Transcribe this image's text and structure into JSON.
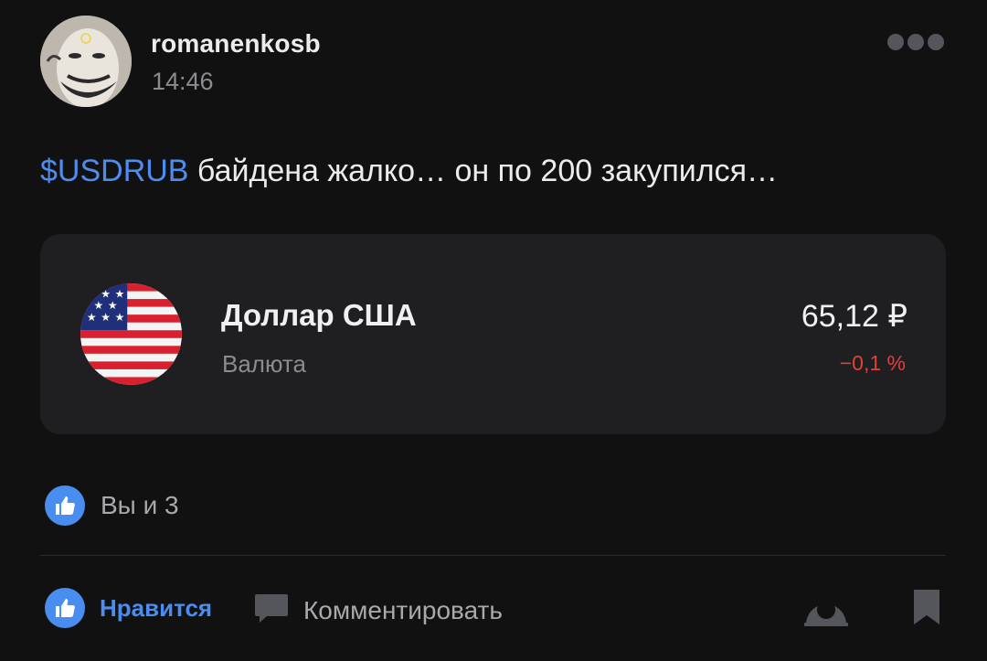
{
  "post": {
    "author": "romanenkosb",
    "time": "14:46",
    "ticker": "$USDRUB",
    "text": " байдена жалко… он по 200 закупился…"
  },
  "instrument": {
    "name": "Доллар США",
    "type": "Валюта",
    "price": "65,12 ₽",
    "change": "−0,1 %",
    "flag_icon": "us-flag-icon"
  },
  "reactions": {
    "likes_summary": "Вы и 3"
  },
  "actions": {
    "like_label": "Нравится",
    "comment_label": "Комментировать"
  },
  "colors": {
    "background": "#111112",
    "card": "#1f1f21",
    "accent": "#4a8df0",
    "negative": "#e0403a",
    "muted": "#8b8b90"
  },
  "icons": [
    "more-icon",
    "thumbs-up-icon",
    "comment-icon",
    "share-icon",
    "bookmark-icon"
  ]
}
